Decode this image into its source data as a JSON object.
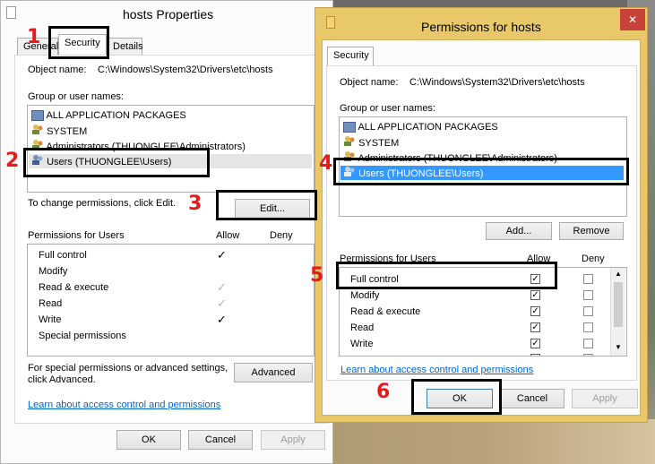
{
  "annotations": [
    "1",
    "2",
    "3",
    "4",
    "5",
    "6"
  ],
  "left": {
    "title": "hosts Properties",
    "tabs": [
      "General",
      "Security",
      "Details"
    ],
    "object_label": "Object name:",
    "object_value": "C:\\Windows\\System32\\Drivers\\etc\\hosts",
    "group_label": "Group or user names:",
    "users": [
      "ALL APPLICATION PACKAGES",
      "SYSTEM",
      "Administrators (THUONGLEE\\Administrators)",
      "Users (THUONGLEE\\Users)"
    ],
    "change_text": "To change permissions, click Edit.",
    "edit_label": "Edit...",
    "perm_header": "Permissions for Users",
    "allow": "Allow",
    "deny": "Deny",
    "perms": [
      "Full control",
      "Modify",
      "Read & execute",
      "Read",
      "Write",
      "Special permissions"
    ],
    "perm_allow": [
      true,
      false,
      "grey",
      "grey",
      true,
      false
    ],
    "special_text_1": "For special permissions or advanced settings,",
    "special_text_2": "click Advanced.",
    "advanced_label": "Advanced",
    "link": "Learn about access control and permissions",
    "ok": "OK",
    "cancel": "Cancel",
    "apply": "Apply"
  },
  "right": {
    "title": "Permissions for hosts",
    "close": "✕",
    "tab": "Security",
    "object_label": "Object name:",
    "object_value": "C:\\Windows\\System32\\Drivers\\etc\\hosts",
    "group_label": "Group or user names:",
    "users": [
      "ALL APPLICATION PACKAGES",
      "SYSTEM",
      "Administrators (THUONGLEE\\Administrators)",
      "Users (THUONGLEE\\Users)"
    ],
    "add_label": "Add...",
    "remove_label": "Remove",
    "perm_header": "Permissions for Users",
    "allow": "Allow",
    "deny": "Deny",
    "perms": [
      "Full control",
      "Modify",
      "Read & execute",
      "Read",
      "Write"
    ],
    "link": "Learn about access control and permissions",
    "ok": "OK",
    "cancel": "Cancel",
    "apply": "Apply"
  },
  "colors": {
    "annotation": "#e8191c",
    "selection": "#3399ff",
    "title_bar_active": "#e8c868"
  }
}
